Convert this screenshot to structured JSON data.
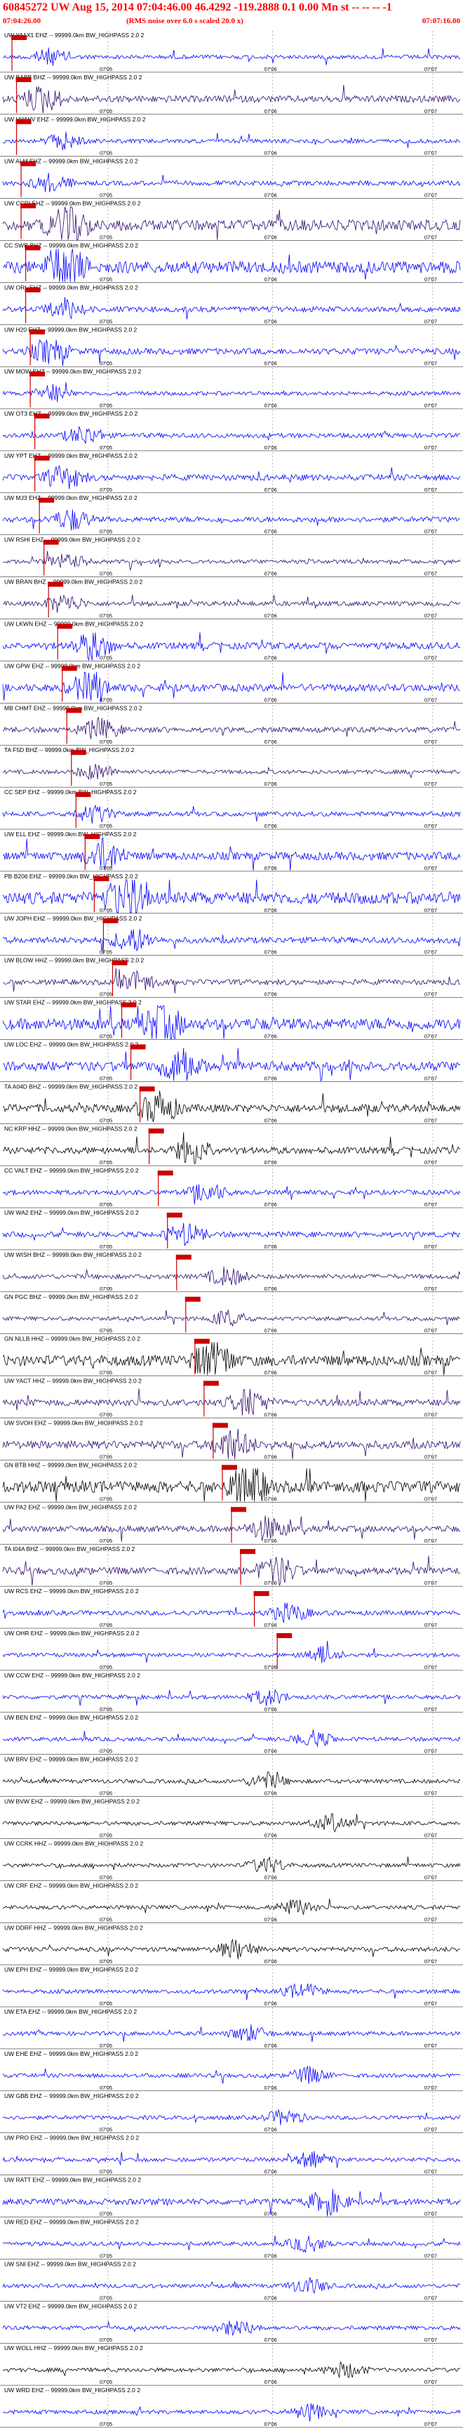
{
  "header": {
    "title": "60845272 UW Aug 15, 2014 07:04:46.00   46.4292 -119.2888  0.1 0.00 Mn st -- -- -- -1",
    "subtitle": "(RMS noise over 6.0 s scaled 20.0 x)",
    "start_time": "07:04:26.00",
    "end_time": "07:07:16.00"
  },
  "colors": {
    "blue": "#0000ff",
    "black": "#000000",
    "indigo": "#2e0b6e",
    "pick": "#cc0000",
    "grid": "#888888"
  },
  "chart_data": {
    "type": "line",
    "title": "60845272 UW Aug 15, 2014 07:04:46.00   46.4292 -119.2888  0.1 0.00 Mn st -- -- -- -1",
    "time_ticks": [
      "07'05",
      "07'06",
      "07'07"
    ],
    "time_range": [
      "07:04:26.00",
      "07:07:16.00"
    ],
    "channels": [
      {
        "label": "UW YA1X1 EHZ -- 99999.0km BW_HIGHPASS  2.0  2",
        "color": "blue",
        "amp": 0.3,
        "pick": 0.02
      },
      {
        "label": "UW BABB BHZ -- 99999.0km BW_HIGHPASS  2.0  2",
        "color": "indigo",
        "amp": 0.5,
        "pick": 0.03
      },
      {
        "label": "UW HWWV EHZ -- 99999.0km BW_HIGHPASS  2.0  2",
        "color": "blue",
        "amp": 0.3,
        "pick": 0.03
      },
      {
        "label": "UW ALM EHZ -- 99999.0km BW_HIGHPASS  2.0  2",
        "color": "blue",
        "amp": 0.35,
        "pick": 0.04
      },
      {
        "label": "UW CCRI EHZ -- 99999.0km BW_HIGHPASS  2.0  2",
        "color": "indigo",
        "amp": 0.8,
        "pick": 0.04
      },
      {
        "label": "CC SWB BHZ -- 99999.0km BW_HIGHPASS  2.0  2",
        "color": "blue",
        "amp": 0.9,
        "pick": 0.05
      },
      {
        "label": "UW ORL EHZ -- 99999.0km BW_HIGHPASS  2.0  2",
        "color": "blue",
        "amp": 0.4,
        "pick": 0.05
      },
      {
        "label": "UW H20 EHZ -- 99999.0km BW_HIGHPASS  2.0  2",
        "color": "blue",
        "amp": 0.45,
        "pick": 0.06
      },
      {
        "label": "UW MOW EHZ -- 99999.0km BW_HIGHPASS  2.0  2",
        "color": "blue",
        "amp": 0.3,
        "pick": 0.06
      },
      {
        "label": "UW OT3 EHZ -- 99999.0km BW_HIGHPASS  2.0  2",
        "color": "blue",
        "amp": 0.35,
        "pick": 0.07
      },
      {
        "label": "UW YPT EHZ -- 99999.0km BW_HIGHPASS  2.0  2",
        "color": "blue",
        "amp": 0.45,
        "pick": 0.07
      },
      {
        "label": "UW MJ3 EHZ -- 99999.0km BW_HIGHPASS  2.0  2",
        "color": "blue",
        "amp": 0.4,
        "pick": 0.08
      },
      {
        "label": "UW RSHI EHZ -- 99999.0km BW_HIGHPASS  2.0  2",
        "color": "indigo",
        "amp": 0.3,
        "pick": 0.09
      },
      {
        "label": "UW BRAN BHZ -- 99999.0km BW_HIGHPASS  2.0  2",
        "color": "indigo",
        "amp": 0.35,
        "pick": 0.1
      },
      {
        "label": "UW LKWN EHZ -- 99999.0km BW_HIGHPASS  2.0  2",
        "color": "blue",
        "amp": 0.5,
        "pick": 0.12
      },
      {
        "label": "UW GPW EHZ -- 99999.0km BW_HIGHPASS  2.0  2",
        "color": "blue",
        "amp": 0.55,
        "pick": 0.13
      },
      {
        "label": "MB CHMT EHZ -- 99999.0km BW_HIGHPASS  2.0  2",
        "color": "indigo",
        "amp": 0.4,
        "pick": 0.14
      },
      {
        "label": "TA F5D BHZ -- 99999.0km BW_HIGHPASS  2.0  2",
        "color": "indigo",
        "amp": 0.3,
        "pick": 0.15
      },
      {
        "label": "CC SEP EHZ -- 99999.0km BW_HIGHPASS  2.0  2",
        "color": "blue",
        "amp": 0.35,
        "pick": 0.16
      },
      {
        "label": "UW ELL EHZ -- 99999.0km BW_HIGHPASS  2.0  2",
        "color": "blue",
        "amp": 0.6,
        "pick": 0.18
      },
      {
        "label": "PB B206 EHZ -- 99999.0km BW_HIGHPASS  2.0  2",
        "color": "blue",
        "amp": 0.9,
        "pick": 0.2
      },
      {
        "label": "UW JOPH EHZ -- 99999.0km BW_HIGHPASS  2.0  2",
        "color": "blue",
        "amp": 0.45,
        "pick": 0.22
      },
      {
        "label": "UW BLOW HHZ -- 99999.0km BW_HIGHPASS  2.0  2",
        "color": "indigo",
        "amp": 0.4,
        "pick": 0.24
      },
      {
        "label": "UW STAR EHZ -- 99999.0km BW_HIGHPASS  2.0  2",
        "color": "blue",
        "amp": 0.85,
        "pick": 0.26
      },
      {
        "label": "UW LOC EHZ -- 99999.0km BW_HIGHPASS  2.0  2",
        "color": "blue",
        "amp": 0.7,
        "pick": 0.28
      },
      {
        "label": "TA A04D BHZ -- 99999.0km BW_HIGHPASS  2.0  2",
        "color": "black",
        "amp": 0.6,
        "pick": 0.3
      },
      {
        "label": "NC KRP HHZ -- 99999.0km BW_HIGHPASS  2.0  2",
        "color": "black",
        "amp": 0.5,
        "pick": 0.32
      },
      {
        "label": "CC VALT EHZ -- 99999.0km BW_HIGHPASS  2.0  2",
        "color": "blue",
        "amp": 0.35,
        "pick": 0.34
      },
      {
        "label": "UW WA2 EHZ -- 99999.0km BW_HIGHPASS  2.0  2",
        "color": "blue",
        "amp": 0.4,
        "pick": 0.36
      },
      {
        "label": "UW WISH BHZ -- 99999.0km BW_HIGHPASS  2.0  2",
        "color": "indigo",
        "amp": 0.35,
        "pick": 0.38
      },
      {
        "label": "GN PGC BHZ -- 99999.0km BW_HIGHPASS  2.0  2",
        "color": "indigo",
        "amp": 0.3,
        "pick": 0.4
      },
      {
        "label": "GN NLLB HHZ -- 99999.0km BW_HIGHPASS  2.0  2",
        "color": "black",
        "amp": 0.8,
        "pick": 0.42
      },
      {
        "label": "UW YACT HHZ -- 99999.0km BW_HIGHPASS  2.0  2",
        "color": "indigo",
        "amp": 0.5,
        "pick": 0.44
      },
      {
        "label": "UW SVOH EHZ -- 99999.0km BW_HIGHPASS  2.0  2",
        "color": "indigo",
        "amp": 0.6,
        "pick": 0.46
      },
      {
        "label": "GN BTB HHZ -- 99999.0km BW_HIGHPASS  2.0  2",
        "color": "black",
        "amp": 0.85,
        "pick": 0.48
      },
      {
        "label": "UW PA2 EHZ -- 99999.0km BW_HIGHPASS  2.0  2",
        "color": "indigo",
        "amp": 0.45,
        "pick": 0.5
      },
      {
        "label": "TA I04A BHZ -- 99999.0km BW_HIGHPASS  2.0  2",
        "color": "indigo",
        "amp": 0.55,
        "pick": 0.52
      },
      {
        "label": "UW RCS EHZ -- 99999.0km BW_HIGHPASS  2.0  2",
        "color": "blue",
        "amp": 0.35,
        "pick": 0.55
      },
      {
        "label": "UW OHR EHZ -- 99999.0km BW_HIGHPASS  2.0  2",
        "color": "blue",
        "amp": 0.3,
        "pick": 0.6
      },
      {
        "label": "UW CCW EHZ -- 99999.0km BW_HIGHPASS  2.0  2",
        "color": "blue",
        "amp": 0.3,
        "pick": null
      },
      {
        "label": "UW BEN EHZ -- 99999.0km BW_HIGHPASS  2.0  2",
        "color": "blue",
        "amp": 0.3,
        "pick": null
      },
      {
        "label": "UW BRV EHZ -- 99999.0km BW_HIGHPASS  2.0  2",
        "color": "black",
        "amp": 0.3,
        "pick": null
      },
      {
        "label": "UW BVW EHZ -- 99999.0km BW_HIGHPASS  2.0  2",
        "color": "black",
        "amp": 0.3,
        "pick": null
      },
      {
        "label": "UW CCRK HHZ -- 99999.0km BW_HIGHPASS  2.0  2",
        "color": "black",
        "amp": 0.3,
        "pick": null
      },
      {
        "label": "UW CRF EHZ -- 99999.0km BW_HIGHPASS  2.0  2",
        "color": "black",
        "amp": 0.3,
        "pick": null
      },
      {
        "label": "UW DDRF HHZ -- 99999.0km BW_HIGHPASS  2.0  2",
        "color": "black",
        "amp": 0.35,
        "pick": null
      },
      {
        "label": "UW EPH EHZ -- 99999.0km BW_HIGHPASS  2.0  2",
        "color": "blue",
        "amp": 0.3,
        "pick": null
      },
      {
        "label": "UW ETA EHZ -- 99999.0km BW_HIGHPASS  2.0  2",
        "color": "blue",
        "amp": 0.3,
        "pick": null
      },
      {
        "label": "UW EHE EHZ -- 99999.0km BW_HIGHPASS  2.0  2",
        "color": "blue",
        "amp": 0.3,
        "pick": null
      },
      {
        "label": "UW GBB EHZ -- 99999.0km BW_HIGHPASS  2.0  2",
        "color": "blue",
        "amp": 0.3,
        "pick": null
      },
      {
        "label": "UW PRO EHZ -- 99999.0km BW_HIGHPASS  2.0  2",
        "color": "blue",
        "amp": 0.3,
        "pick": null
      },
      {
        "label": "UW RATT EHZ -- 99999.0km BW_HIGHPASS  2.0  2",
        "color": "blue",
        "amp": 0.45,
        "pick": null
      },
      {
        "label": "UW RED EHZ -- 99999.0km BW_HIGHPASS  2.0  2",
        "color": "blue",
        "amp": 0.3,
        "pick": null
      },
      {
        "label": "UW SNI EHZ -- 99999.0km BW_HIGHPASS  2.0  2",
        "color": "blue",
        "amp": 0.3,
        "pick": null
      },
      {
        "label": "UW VT2 EHZ -- 99999.0km BW_HIGHPASS  2.0  2",
        "color": "blue",
        "amp": 0.3,
        "pick": null
      },
      {
        "label": "UW WOLL HHZ -- 99999.0km BW_HIGHPASS  2.0  2",
        "color": "black",
        "amp": 0.3,
        "pick": null
      },
      {
        "label": "UW WRD EHZ -- 99999.0km BW_HIGHPASS  2.0  2",
        "color": "blue",
        "amp": 0.3,
        "pick": null
      }
    ]
  }
}
